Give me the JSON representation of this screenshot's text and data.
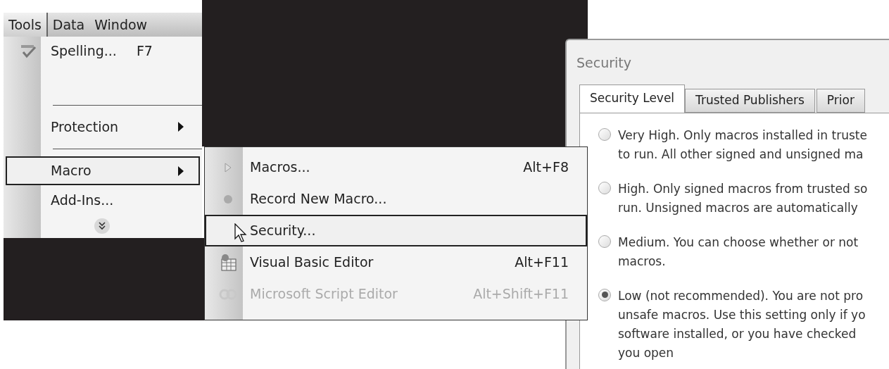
{
  "menu_bar": [
    {
      "label": "Tools",
      "selected": true
    },
    {
      "label": "Data",
      "selected": false
    },
    {
      "label": "Window",
      "selected": false
    }
  ],
  "tools_menu": {
    "items": [
      {
        "kind": "item",
        "label": "Spelling...",
        "shortcut": "F7",
        "highlighted": false,
        "submenu": false
      },
      {
        "kind": "gap"
      },
      {
        "kind": "separator"
      },
      {
        "kind": "item",
        "label": "Protection",
        "highlighted": false,
        "submenu": true
      },
      {
        "kind": "separator"
      },
      {
        "kind": "item",
        "label": "Macro",
        "highlighted": true,
        "submenu": true
      },
      {
        "kind": "item",
        "label": "Add-Ins...",
        "highlighted": false,
        "submenu": false
      },
      {
        "kind": "expand"
      }
    ]
  },
  "macro_menu": {
    "items": [
      {
        "label": "Macros...",
        "shortcut": "Alt+F8",
        "highlighted": false,
        "disabled": false
      },
      {
        "label": "Record New Macro...",
        "highlighted": false,
        "disabled": false
      },
      {
        "label": "Security...",
        "highlighted": true,
        "disabled": false
      },
      {
        "label": "Visual Basic Editor",
        "shortcut": "Alt+F11",
        "highlighted": false,
        "disabled": false
      },
      {
        "label": "Microsoft Script Editor",
        "shortcut": "Alt+Shift+F11",
        "highlighted": false,
        "disabled": true
      }
    ]
  },
  "dialog": {
    "title": "Security",
    "tabs": [
      {
        "label": "Security Level",
        "selected": true
      },
      {
        "label": "Trusted Publishers",
        "selected": false
      },
      {
        "label": "Prior",
        "selected": false
      }
    ],
    "options": [
      {
        "lines": [
          "Very High. Only macros installed in truste",
          "to run. All other signed and unsigned ma"
        ],
        "selected": false
      },
      {
        "lines": [
          "High. Only signed macros from trusted so",
          "run. Unsigned macros are automatically"
        ],
        "selected": false
      },
      {
        "lines": [
          "Medium. You can choose whether or not",
          "macros."
        ],
        "selected": false
      },
      {
        "lines": [
          "Low (not recommended). You are not pro",
          "unsafe macros. Use this setting only if yo",
          "software installed, or you have checked",
          "you open"
        ],
        "selected": true
      }
    ]
  }
}
